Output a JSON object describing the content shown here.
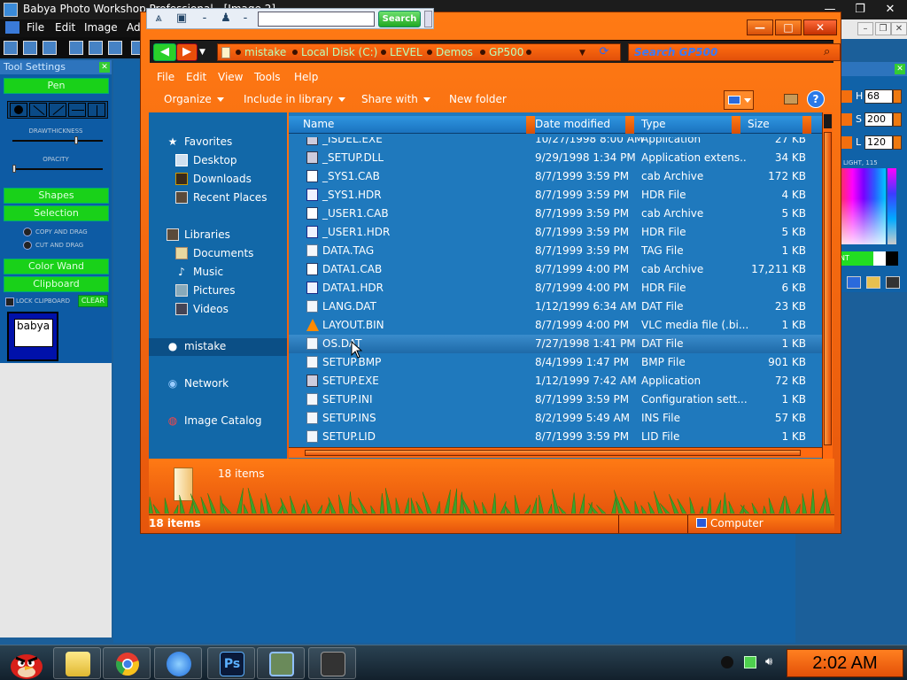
{
  "background_app": {
    "title": "Babya Photo Workshop Professional - [Image 2]",
    "menu": [
      "File",
      "Edit",
      "Image",
      "Ad"
    ],
    "tool_panel": {
      "title": "Tool Settings",
      "pen_button": "Pen",
      "draw_thickness_label": "DRAWTHICKNESS",
      "opacity_label": "OPACITY",
      "shapes_button": "Shapes",
      "selection_button": "Selection",
      "radio_1": "COPY AND DRAG",
      "radio_2": "CUT AND DRAG",
      "color_wand_button": "Color Wand",
      "clipboard_button": "Clipboard",
      "lock_label": "LOCK CLIPBOARD",
      "clear_button": "CLEAR",
      "preview_text": "babya"
    },
    "color_panel": {
      "h_label": "H",
      "h_value": "68",
      "s_label": "S",
      "s_value": "200",
      "l_label": "L",
      "l_value": "120",
      "small_label": "LIGHT, 115",
      "bar_label": "NT"
    }
  },
  "mini_toolbar": {
    "search_button": "Search"
  },
  "explorer": {
    "window_controls": {
      "minimize": "—",
      "maximize": "□",
      "close": "✕"
    },
    "breadcrumb": [
      "mistake",
      "Local Disk (C:)",
      "LEVEL",
      "Demos",
      "GP500"
    ],
    "search_placeholder": "Search GP500",
    "menu": [
      "File",
      "Edit",
      "View",
      "Tools",
      "Help"
    ],
    "commands": {
      "organize": "Organize",
      "include_in_library": "Include in library",
      "share_with": "Share with",
      "new_folder": "New folder"
    },
    "nav": {
      "favorites": "Favorites",
      "desktop": "Desktop",
      "downloads": "Downloads",
      "recent_places": "Recent Places",
      "libraries": "Libraries",
      "documents": "Documents",
      "music": "Music",
      "pictures": "Pictures",
      "videos": "Videos",
      "mistake": "mistake",
      "network": "Network",
      "image_catalog": "Image Catalog"
    },
    "columns": {
      "name": "Name",
      "date": "Date modified",
      "type": "Type",
      "size": "Size"
    },
    "files": [
      {
        "name": "_ISDEL.EXE",
        "date": "10/27/1998 8:00 AM",
        "type": "Application",
        "size": "27 KB",
        "icon": "app"
      },
      {
        "name": "_SETUP.DLL",
        "date": "9/29/1998 1:34 PM",
        "type": "Application extens...",
        "size": "34 KB",
        "icon": "app"
      },
      {
        "name": "_SYS1.CAB",
        "date": "8/7/1999 3:59 PM",
        "type": "cab Archive",
        "size": "172 KB",
        "icon": "cab"
      },
      {
        "name": "_SYS1.HDR",
        "date": "8/7/1999 3:59 PM",
        "type": "HDR File",
        "size": "4 KB",
        "icon": "hdr"
      },
      {
        "name": "_USER1.CAB",
        "date": "8/7/1999 3:59 PM",
        "type": "cab Archive",
        "size": "5 KB",
        "icon": "cab"
      },
      {
        "name": "_USER1.HDR",
        "date": "8/7/1999 3:59 PM",
        "type": "HDR File",
        "size": "5 KB",
        "icon": "hdr"
      },
      {
        "name": "DATA.TAG",
        "date": "8/7/1999 3:59 PM",
        "type": "TAG File",
        "size": "1 KB",
        "icon": "doc"
      },
      {
        "name": "DATA1.CAB",
        "date": "8/7/1999 4:00 PM",
        "type": "cab Archive",
        "size": "17,211 KB",
        "icon": "cab"
      },
      {
        "name": "DATA1.HDR",
        "date": "8/7/1999 4:00 PM",
        "type": "HDR File",
        "size": "6 KB",
        "icon": "hdr"
      },
      {
        "name": "LANG.DAT",
        "date": "1/12/1999 6:34 AM",
        "type": "DAT File",
        "size": "23 KB",
        "icon": "doc"
      },
      {
        "name": "LAYOUT.BIN",
        "date": "8/7/1999 4:00 PM",
        "type": "VLC media file (.bi...",
        "size": "1 KB",
        "icon": "vlc"
      },
      {
        "name": "OS.DAT",
        "date": "7/27/1998 1:41 PM",
        "type": "DAT File",
        "size": "1 KB",
        "icon": "doc"
      },
      {
        "name": "SETUP.BMP",
        "date": "8/4/1999 1:47 PM",
        "type": "BMP File",
        "size": "901 KB",
        "icon": "doc"
      },
      {
        "name": "SETUP.EXE",
        "date": "1/12/1999 7:42 AM",
        "type": "Application",
        "size": "72 KB",
        "icon": "app"
      },
      {
        "name": "SETUP.INI",
        "date": "8/7/1999 3:59 PM",
        "type": "Configuration sett...",
        "size": "1 KB",
        "icon": "doc"
      },
      {
        "name": "SETUP.INS",
        "date": "8/2/1999 5:49 AM",
        "type": "INS File",
        "size": "57 KB",
        "icon": "doc"
      },
      {
        "name": "SETUP.LID",
        "date": "8/7/1999 3:59 PM",
        "type": "LID File",
        "size": "1 KB",
        "icon": "doc"
      }
    ],
    "details_count": "18 items",
    "status_count": "18 items",
    "status_location": "Computer"
  },
  "taskbar": {
    "clock": "2:02 AM"
  },
  "colors": {
    "accent_orange": "#ff7a14",
    "list_blue": "#1f79bd",
    "crumb_text": "#baffba"
  }
}
